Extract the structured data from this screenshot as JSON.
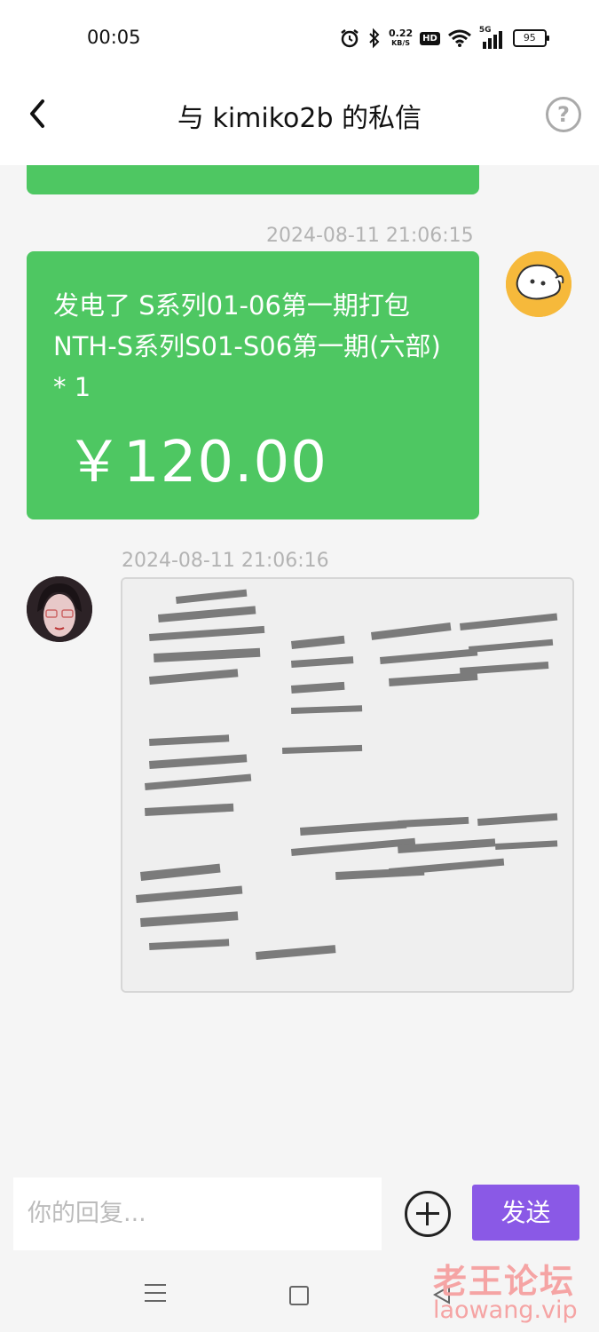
{
  "status_bar": {
    "time": "00:05",
    "net_speed_value": "0.22",
    "net_speed_unit": "KB/S",
    "hd": "HD",
    "signal": "5G",
    "battery": "95",
    "icons": [
      "alarm-icon",
      "bluetooth-icon",
      "wifi-icon",
      "signal-icon"
    ]
  },
  "header": {
    "title": "与 kimiko2b 的私信",
    "help_icon": "?"
  },
  "messages": [
    {
      "timestamp": "2024-08-11 21:06:15",
      "sender": "self",
      "order_text": "发电了 S系列01-06第一期打包 NTH-S系列S01-S06第一期(六部) * 1",
      "price": "￥120.00"
    },
    {
      "timestamp": "2024-08-11 21:06:16",
      "sender": "other",
      "type": "image"
    }
  ],
  "input": {
    "placeholder": "你的回复...",
    "send_label": "发送"
  },
  "watermark": {
    "cn": "老王论坛",
    "url": "laowang.vip"
  },
  "colors": {
    "bubble": "#4ec762",
    "send": "#8a59e6",
    "timestamp": "#b3b3b3"
  }
}
